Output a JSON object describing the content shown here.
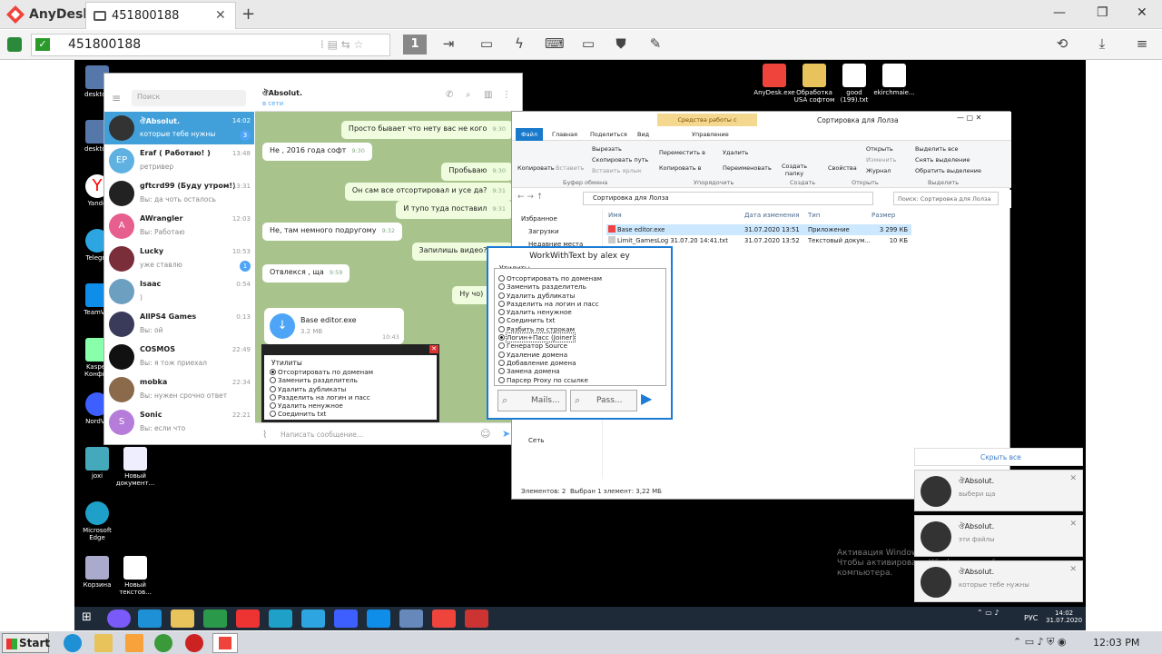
{
  "anydesk": {
    "app_name": "AnyDesk",
    "tab_label": "451800188",
    "address": "451800188",
    "session_number": "1",
    "colors": {
      "brand": "#ef443b"
    }
  },
  "desktop_icons": [
    {
      "label": "desktop",
      "icon": "monitor-icon"
    },
    {
      "label": "desktop",
      "icon": "monitor-icon"
    },
    {
      "label": "Yande",
      "icon": "yandex-icon"
    },
    {
      "label": "Telegra",
      "icon": "telegram-icon"
    },
    {
      "label": "TeamVie",
      "icon": "teamviewer-icon"
    },
    {
      "label": "Kasper Конфиг",
      "icon": "kaspersky-icon"
    },
    {
      "label": "NordVP",
      "icon": "nordvpn-icon"
    },
    {
      "label": "joxi",
      "icon": "joxi-icon"
    },
    {
      "label": "Новый документ...",
      "icon": "doc-icon"
    },
    {
      "label": "Microsoft Edge",
      "icon": "edge-icon"
    },
    {
      "label": "Корзина",
      "icon": "recycle-bin-icon"
    },
    {
      "label": "Новый текстов...",
      "icon": "doc-icon"
    },
    {
      "label": "AnyDesk.exe",
      "icon": "anydesk-icon"
    },
    {
      "label": "Обработка USA софтом",
      "icon": "folder-icon"
    },
    {
      "label": "good (199).txt",
      "icon": "doc-icon"
    },
    {
      "label": "ekirchmaie...",
      "icon": "doc-icon"
    }
  ],
  "telegram": {
    "search_placeholder": "Поиск",
    "header_name": "ঔAbsolut.",
    "header_status": "в сети",
    "input_placeholder": "Написать сообщение...",
    "chats": [
      {
        "name": "ঔAbsolut.",
        "preview": "которые тебе нужны",
        "time": "14:02",
        "badge": "3",
        "initials": "",
        "color": "#333"
      },
      {
        "name": "Eraf ( Работаю! )",
        "preview": "ретривер",
        "time": "13:48",
        "badge": "",
        "initials": "EP",
        "color": "#5eb1e0"
      },
      {
        "name": "gftcrd99 (Буду утром!)",
        "preview": "Вы: да чоть осталось",
        "time": "13:31",
        "badge": "",
        "initials": "",
        "color": "#222"
      },
      {
        "name": "AWrangler",
        "preview": "Вы: Работаю",
        "time": "12:03",
        "badge": "",
        "initials": "A",
        "color": "#e65f8f"
      },
      {
        "name": "Lucky",
        "preview": "уже ставлю",
        "time": "10:53",
        "badge": "1",
        "initials": "",
        "color": "#7a2e3a"
      },
      {
        "name": "Isaac",
        "preview": ")",
        "time": "0:54",
        "badge": "",
        "initials": "",
        "color": "#6da0c0"
      },
      {
        "name": "AllPS4 Games",
        "preview": "Вы: ой",
        "time": "0:13",
        "badge": "",
        "initials": "",
        "color": "#3a3a5a"
      },
      {
        "name": "COSMOS",
        "preview": "Вы: я тож приехал",
        "time": "22:49",
        "badge": "",
        "initials": "",
        "color": "#111"
      },
      {
        "name": "mobka",
        "preview": "Вы: нужен срочно ответ",
        "time": "22:34",
        "badge": "",
        "initials": "",
        "color": "#8a6a4a"
      },
      {
        "name": "Sonic",
        "preview": "Вы: если что",
        "time": "22:21",
        "badge": "",
        "initials": "S",
        "color": "#b57cd9"
      }
    ],
    "messages": [
      {
        "text": "Просто бывает что нету вас не кого",
        "time": "9:30",
        "out": true
      },
      {
        "text": "Не , 2016 года софт",
        "time": "9:30",
        "out": false
      },
      {
        "text": "Пробьваю",
        "time": "9:30",
        "out": true
      },
      {
        "text": "Он сам все отсортировал и усе да?",
        "time": "9:31",
        "out": true
      },
      {
        "text": "И тупо туда поставил",
        "time": "9:31",
        "out": true
      },
      {
        "text": "Не, там немного подругому",
        "time": "9:32",
        "out": false
      },
      {
        "text": "Запилишь видео?",
        "time": "9:39",
        "out": true
      },
      {
        "text": "Отвлекся , ща",
        "time": "9:59",
        "out": false
      },
      {
        "text": "Ну чо)",
        "time": "10:43",
        "out": true
      }
    ],
    "file": {
      "name": "Base editor.exe",
      "size": "3.2 MB",
      "time": "10:43"
    },
    "dialog": {
      "group": "Утилиты",
      "options": [
        "Отсортировать по доменам",
        "Заменить разделитель",
        "Удалить дубликаты",
        "Разделить на логин и пасс",
        "Удалить ненужное",
        "Соединить txt"
      ]
    }
  },
  "explorer": {
    "context_tab": "Средства работы с приложениями",
    "title": "Сортировка для Лолза",
    "tabs": [
      "Файл",
      "Главная",
      "Поделиться",
      "Вид",
      "Управление"
    ],
    "ribbon": {
      "copy": "Копировать",
      "paste": "Вставить",
      "cut": "Вырезать",
      "copy_path": "Скопировать путь",
      "paste_shortcut": "Вставить ярлык",
      "clipboard": "Буфер обмена",
      "move_to": "Переместить в",
      "copy_to": "Копировать в",
      "delete": "Удалить",
      "rename": "Переименовать",
      "organize": "Упорядочить",
      "new_folder": "Создать папку",
      "create": "Создать",
      "properties": "Свойства",
      "open": "Открыть",
      "edit": "Изменить",
      "history": "Журнал",
      "open_grp": "Открыть",
      "select_all": "Выделить все",
      "select_none": "Снять выделение",
      "invert": "Обратить выделение",
      "select_grp": "Выделить"
    },
    "path": "Сортировка для Лолза",
    "search_placeholder": "Поиск: Сортировка для Лолза",
    "nav": [
      "Избранное",
      "Загрузки",
      "Недавние места",
      "Сеть"
    ],
    "columns": [
      "Имя",
      "Дата изменения",
      "Тип",
      "Размер"
    ],
    "files": [
      {
        "name": "Base editor.exe",
        "date": "31.07.2020 13:51",
        "type": "Приложение",
        "size": "3 299 КБ"
      },
      {
        "name": "Limit_GamesLog 31.07.20 14:41.txt",
        "date": "31.07.2020 13:52",
        "type": "Текстовый докум...",
        "size": "10 КБ"
      }
    ],
    "status_items": "Элементов: 2",
    "status_selected": "Выбран 1 элемент: 3,22 МБ"
  },
  "workwithtext": {
    "title": "WorkWithText by alex ey",
    "group": "Утилиты",
    "options": [
      "Отсортировать по доменам",
      "Заменить разделитель",
      "Удалить дубликаты",
      "Разделить на логин и пасс",
      "Удалить ненужное",
      "Соединить txt",
      "Разбить по строкам",
      "Логин+Пасс (Joiner)",
      "Генератор Source",
      "Удаление домена",
      "Добавление домена",
      "Замена домена",
      "Парсер Proxy по ссылке"
    ],
    "selected_index": 7,
    "mails_btn": "Mails...",
    "pass_btn": "Pass..."
  },
  "notifications": {
    "hide_all": "Скрыть все",
    "items": [
      {
        "name": "ঔAbsolut.",
        "text": "выбери ща"
      },
      {
        "name": "ঔAbsolut.",
        "text": "эти файлы"
      },
      {
        "name": "ঔAbsolut.",
        "text": "которые тебе нужны"
      }
    ]
  },
  "watermark": {
    "line1": "Активация Windows",
    "line2": "Чтобы активировать Windows, перейдите в раздел",
    "line3": "компьютера."
  },
  "remote_taskbar": {
    "lang": "РУС",
    "time": "14:02",
    "date": "31.07.2020"
  },
  "local_taskbar": {
    "start": "Start",
    "time": "12:03 PM"
  }
}
